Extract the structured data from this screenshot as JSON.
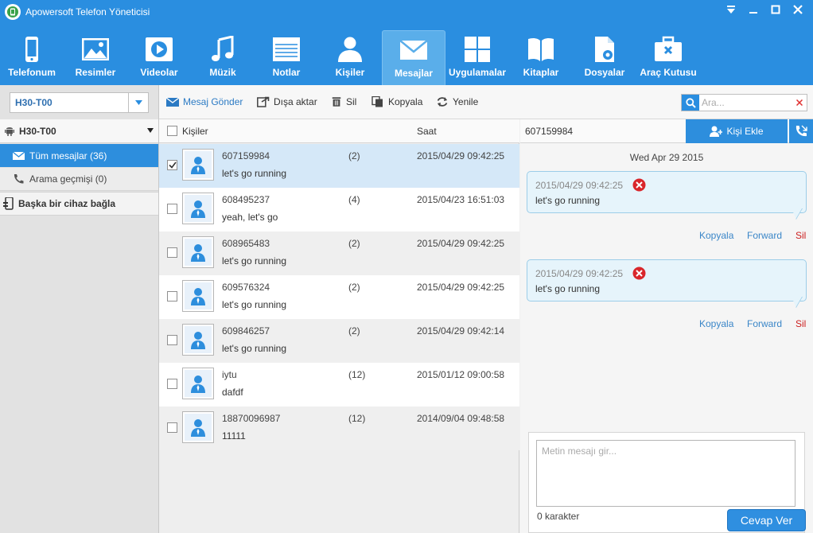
{
  "window": {
    "title": "Apowersoft Telefon Yöneticisi"
  },
  "nav": [
    {
      "label": "Telefonum",
      "icon": "phone-icon"
    },
    {
      "label": "Resimler",
      "icon": "image-icon"
    },
    {
      "label": "Videolar",
      "icon": "video-icon"
    },
    {
      "label": "Müzik",
      "icon": "music-icon"
    },
    {
      "label": "Notlar",
      "icon": "notes-icon"
    },
    {
      "label": "Kişiler",
      "icon": "contacts-icon"
    },
    {
      "label": "Mesajlar",
      "icon": "mail-icon",
      "active": true
    },
    {
      "label": "Uygulamalar",
      "icon": "apps-icon"
    },
    {
      "label": "Kitaplar",
      "icon": "book-icon"
    },
    {
      "label": "Dosyalar",
      "icon": "file-gear-icon"
    },
    {
      "label": "Araç Kutusu",
      "icon": "toolbox-icon"
    }
  ],
  "sidebar": {
    "device_value": "H30-T00",
    "tree_title": "H30-T00",
    "items": [
      {
        "label": "Tüm mesajlar (36)",
        "active": true
      },
      {
        "label": "Arama geçmişi (0)",
        "active": false
      }
    ],
    "connect_label": "Başka bir cihaz bağla"
  },
  "toolbar": {
    "send": "Mesaj Gönder",
    "export": "Dışa aktar",
    "delete": "Sil",
    "copy": "Kopyala",
    "refresh": "Yenile",
    "search_placeholder": "Ara..."
  },
  "list": {
    "col_contacts": "Kişiler",
    "col_time": "Saat",
    "rows": [
      {
        "number": "607159984",
        "message": "let's go running",
        "count": "(2)",
        "time": "2015/04/29 09:42:25",
        "checked": true,
        "selected": true
      },
      {
        "number": "608495237",
        "message": "yeah, let's go",
        "count": "(4)",
        "time": "2015/04/23 16:51:03",
        "checked": false
      },
      {
        "number": "608965483",
        "message": "let's go running",
        "count": "(2)",
        "time": "2015/04/29 09:42:25",
        "checked": false
      },
      {
        "number": "609576324",
        "message": "let's go running",
        "count": "(2)",
        "time": "2015/04/29 09:42:25",
        "checked": false
      },
      {
        "number": "609846257",
        "message": "let's go running",
        "count": "(2)",
        "time": "2015/04/29 09:42:14",
        "checked": false
      },
      {
        "number": "iytu",
        "message": "dafdf",
        "count": "(12)",
        "time": "2015/01/12 09:00:58",
        "checked": false
      },
      {
        "number": "18870096987",
        "message": "11111",
        "count": "(12)",
        "time": "2014/09/04 09:48:58",
        "checked": false
      }
    ]
  },
  "conversation": {
    "contact": "607159984",
    "add_contact": "Kişi Ekle",
    "date": "Wed Apr 29 2015",
    "messages": [
      {
        "time": "2015/04/29 09:42:25",
        "text": "let's go running"
      },
      {
        "time": "2015/04/29 09:42:25",
        "text": "let's go running"
      }
    ],
    "actions": {
      "copy": "Kopyala",
      "forward": "Forward",
      "delete": "Sil"
    },
    "reply_placeholder": "Metin mesajı gir...",
    "char_count": "0 karakter",
    "reply_button": "Cevap Ver"
  },
  "colors": {
    "accent": "#2a8ee0",
    "selected_row": "#d5e8f8",
    "bubble": "#e6f4fb",
    "delete": "#cc2020",
    "link": "#3a86c8"
  }
}
